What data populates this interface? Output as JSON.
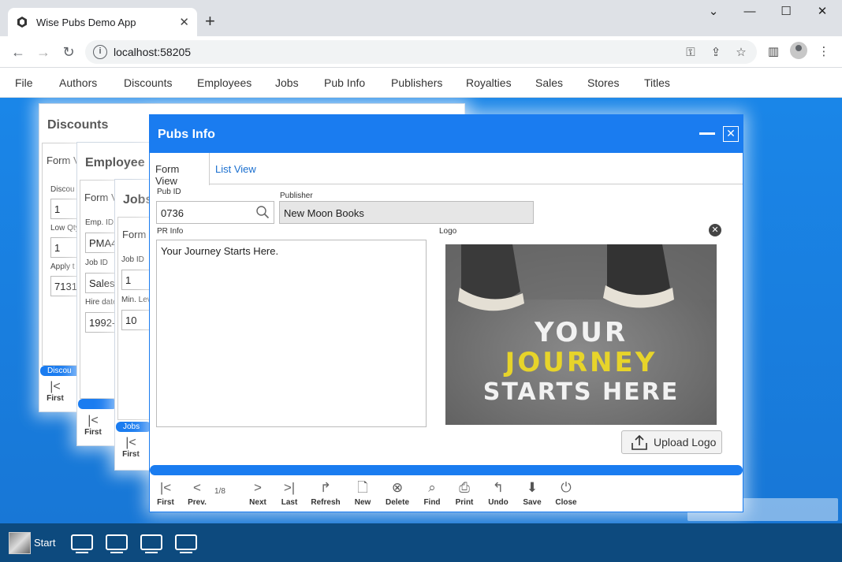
{
  "browser": {
    "tab_title": "Wise Pubs Demo App",
    "url": "localhost:58205"
  },
  "menu": {
    "items": [
      "File",
      "Authors",
      "Discounts",
      "Employees",
      "Jobs",
      "Pub Info",
      "Publishers",
      "Royalties",
      "Sales",
      "Stores",
      "Titles"
    ]
  },
  "bg_windows": {
    "discounts": {
      "title": "Discounts",
      "tab": "Form V",
      "labels": [
        "Discou",
        "Low Qty",
        "Apply t"
      ],
      "values": [
        "1",
        "1",
        "7131"
      ],
      "bar_label": "Discou",
      "first_label": "First"
    },
    "employee": {
      "title": "Employee",
      "tab": "Form V",
      "labels": [
        "Emp. ID",
        "Job ID",
        "Hire date"
      ],
      "values": [
        "PMA4",
        "Sales",
        "1992-"
      ],
      "first_label": "First"
    },
    "jobs": {
      "title": "Jobs",
      "tab": "Form V",
      "labels": [
        "Job ID",
        "Min. Lev"
      ],
      "values": [
        "1",
        "10"
      ],
      "bar_label": "Jobs",
      "first_label": "First"
    }
  },
  "dialog": {
    "title": "Pubs Info",
    "tabs": [
      "Form View",
      "List View"
    ],
    "pub_id_label": "Pub ID",
    "pub_id_value": "0736",
    "publisher_label": "Publisher",
    "publisher_value": "New Moon Books",
    "pr_info_label": "PR Info",
    "pr_info_value": "Your Journey Starts Here.",
    "logo_label": "Logo",
    "logo_text": [
      "YOUR",
      "JOURNEY",
      "STARTS HERE"
    ],
    "upload_label": "Upload Logo",
    "pager": "1/8",
    "nav": [
      {
        "label": "First",
        "icon": "first-icon"
      },
      {
        "label": "Prev.",
        "icon": "prev-icon"
      },
      {
        "label": "Next",
        "icon": "next-icon"
      },
      {
        "label": "Last",
        "icon": "last-icon"
      },
      {
        "label": "Refresh",
        "icon": "refresh-icon"
      },
      {
        "label": "New",
        "icon": "new-icon"
      },
      {
        "label": "Delete",
        "icon": "delete-icon"
      },
      {
        "label": "Find",
        "icon": "find-icon"
      },
      {
        "label": "Print",
        "icon": "print-icon"
      },
      {
        "label": "Undo",
        "icon": "undo-icon"
      },
      {
        "label": "Save",
        "icon": "save-icon"
      },
      {
        "label": "Close",
        "icon": "close-icon"
      }
    ]
  },
  "taskbar": {
    "start_label": "Start"
  },
  "colors": {
    "accent": "#1a7cf0",
    "desktop": "#1a86e8",
    "taskbar": "#0d4a7e"
  }
}
